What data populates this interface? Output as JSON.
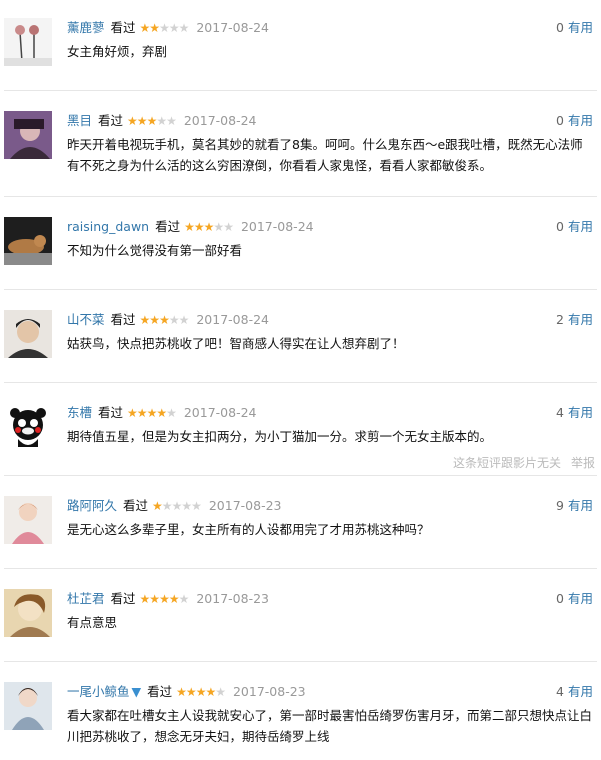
{
  "comments": [
    {
      "user": "薰鹿蓼",
      "action": "看过",
      "rating": 2,
      "date": "2017-08-24",
      "votes": "0",
      "useful_label": "有用",
      "text": "女主角好烦，弃剧",
      "avatar": "roses-avatar"
    },
    {
      "user": "黑目",
      "action": "看过",
      "rating": 3,
      "date": "2017-08-24",
      "votes": "0",
      "useful_label": "有用",
      "text": "昨天开着电视玩手机，莫名其妙的就看了8集。呵呵。什么鬼东西～e跟我吐槽，既然无心法师有不死之身为什么活的这么穷困潦倒，你看看人家鬼怪，看看人家都敏俊系。",
      "avatar": "portrait-avatar"
    },
    {
      "user": "raising_dawn",
      "action": "看过",
      "rating": 3,
      "date": "2017-08-24",
      "votes": "0",
      "useful_label": "有用",
      "text": "不知为什么觉得没有第一部好看",
      "avatar": "cat-avatar"
    },
    {
      "user": "山不菜",
      "action": "看过",
      "rating": 3,
      "date": "2017-08-24",
      "votes": "2",
      "useful_label": "有用",
      "text": "姑获鸟，快点把苏桃收了吧！智商感人得实在让人想弃剧了！",
      "avatar": "man-avatar"
    },
    {
      "user": "东槽",
      "action": "看过",
      "rating": 4,
      "date": "2017-08-24",
      "votes": "4",
      "useful_label": "有用",
      "text": "期待值五星，但是为女主扣两分，为小丁猫加一分。求剪一个无女主版本的。",
      "avatar": "bear-avatar",
      "extra_note": "这条短评跟影片无关",
      "report": "举报"
    },
    {
      "user": "路阿阿久",
      "action": "看过",
      "rating": 1,
      "date": "2017-08-23",
      "votes": "9",
      "useful_label": "有用",
      "text": "是无心这么多辈子里，女主所有的人设都用完了才用苏桃这种吗？",
      "avatar": "girl-avatar"
    },
    {
      "user": "杜芷君",
      "action": "看过",
      "rating": 4,
      "date": "2017-08-23",
      "votes": "0",
      "useful_label": "有用",
      "text": "有点意思",
      "avatar": "cartoon-avatar"
    },
    {
      "user": "一尾小鲸鱼",
      "action": "看过",
      "rating": 4,
      "date": "2017-08-23",
      "votes": "4",
      "useful_label": "有用",
      "text": "看大家都在吐槽女主人设我就安心了，第一部时最害怕岳绮罗伤害月牙，而第二部只想快点让白川把苏桃收了，想念无牙夫妇，期待岳绮罗上线",
      "avatar": "woman-avatar",
      "badge": "whale-icon"
    }
  ],
  "colors": {
    "link": "#3377aa",
    "star_on": "#f5a623",
    "star_off": "#d2d2d2",
    "date": "#999999"
  }
}
